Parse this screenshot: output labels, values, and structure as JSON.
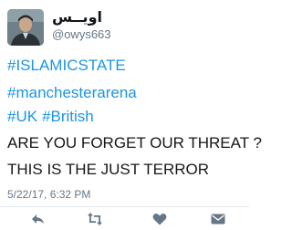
{
  "user": {
    "display_name": "اويــس",
    "handle": "@owys663"
  },
  "tweet": {
    "lines": [
      "#ISLAMICSTATE",
      "#manchesterarena",
      "#UK",
      "#British",
      "ARE YOU FORGET OUR THREAT ?",
      "THIS IS THE JUST TERROR"
    ],
    "timestamp": "5/22/17, 6:32 PM"
  },
  "actions": {
    "reply_icon": "reply-icon",
    "retweet_icon": "retweet-icon",
    "like_icon": "heart-icon",
    "dm_icon": "envelope-icon"
  },
  "colors": {
    "hashtag": "#1b95e0",
    "text": "#14171a",
    "muted": "#657786",
    "divider": "#e1e8ed"
  }
}
